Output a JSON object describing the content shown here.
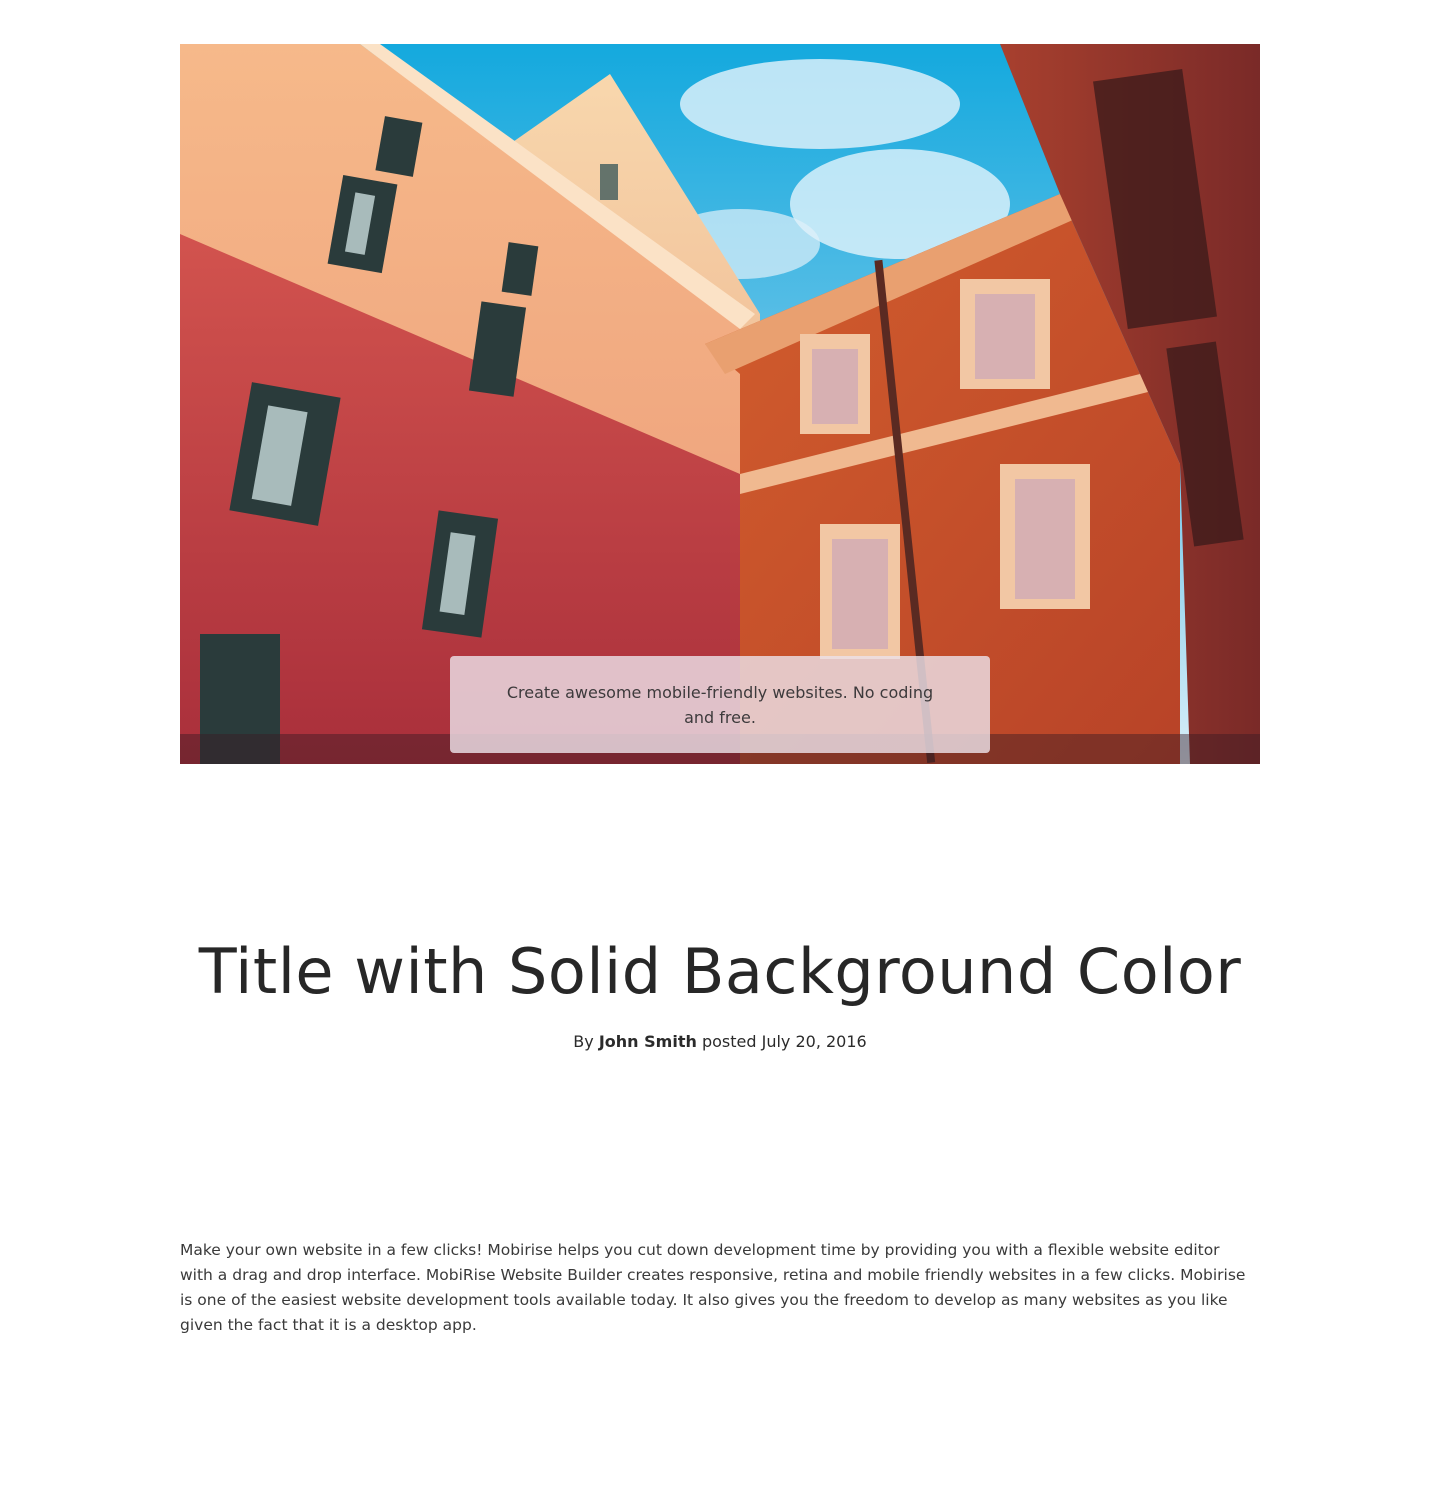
{
  "hero": {
    "image_name": "colorful-buildings-photo",
    "caption": "Create awesome mobile-friendly websites. No coding and free."
  },
  "article": {
    "title": "Title with Solid Background Color",
    "byline": {
      "prefix": "By",
      "author": "John Smith",
      "posted_text": "posted July 20, 2016"
    },
    "body": "Make your own website in a few clicks! Mobirise helps you cut down development time by providing you with a flexible website editor with a drag and drop interface. MobiRise Website Builder creates responsive, retina and mobile friendly websites in a few clicks. Mobirise is one of the easiest website development tools available today. It also gives you the freedom to develop as many websites as you like given the fact that it is a desktop app."
  },
  "colors": {
    "text": "#272727",
    "caption_bg": "#ebe0e8",
    "sky": "#3fb3e0",
    "building_peach": "#f0a77a",
    "building_red": "#c94a44",
    "building_orange": "#d2562d"
  }
}
